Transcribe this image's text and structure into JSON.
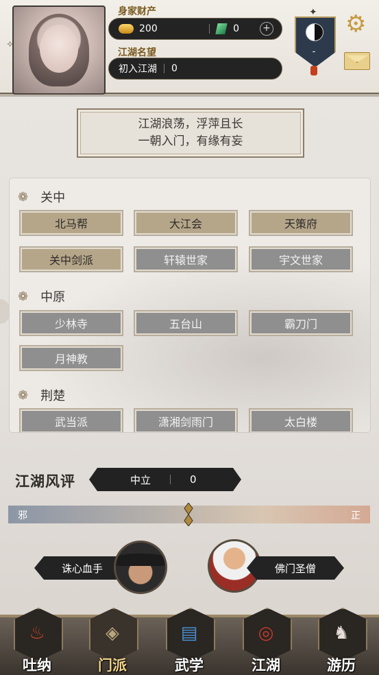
{
  "header": {
    "wealth_label": "身家财产",
    "currency1_value": "200",
    "currency2_value": "0",
    "add_symbol": "+",
    "fame_label": "江湖名望",
    "fame_title": "初入江湖",
    "fame_value": "0",
    "emblem_value": "-",
    "colors": {
      "gold": "#c79a3f",
      "dark_pill": "#232323"
    }
  },
  "motto": {
    "line1": "江湖浪荡，浮萍且长",
    "line2": "一朝入门，有缘有妄"
  },
  "regions": [
    {
      "name": "关中",
      "sects": [
        {
          "label": "北马帮",
          "style": "tan"
        },
        {
          "label": "大江会",
          "style": "tan"
        },
        {
          "label": "天策府",
          "style": "tan"
        },
        {
          "label": "关中剑派",
          "style": "tan"
        },
        {
          "label": "轩辕世家",
          "style": "gray"
        },
        {
          "label": "宇文世家",
          "style": "gray"
        }
      ]
    },
    {
      "name": "中原",
      "sects": [
        {
          "label": "少林寺",
          "style": "gray"
        },
        {
          "label": "五台山",
          "style": "gray"
        },
        {
          "label": "霸刀门",
          "style": "gray"
        },
        {
          "label": "月神教",
          "style": "gray"
        }
      ]
    },
    {
      "name": "荆楚",
      "sects": [
        {
          "label": "武当派",
          "style": "gray"
        },
        {
          "label": "潇湘剑雨门",
          "style": "gray"
        },
        {
          "label": "太白楼",
          "style": "gray"
        }
      ]
    }
  ],
  "reputation": {
    "title": "江湖风评",
    "alignment": "中立",
    "score": "0",
    "left_label": "邪",
    "right_label": "正"
  },
  "archetypes": {
    "evil": "诛心血手",
    "good": "佛门圣僧"
  },
  "nav": [
    {
      "label": "吐纳",
      "icon": "meditation-icon"
    },
    {
      "label": "门派",
      "icon": "sect-icon",
      "active": true
    },
    {
      "label": "武学",
      "icon": "martial-book-icon"
    },
    {
      "label": "江湖",
      "icon": "world-icon"
    },
    {
      "label": "游历",
      "icon": "horse-icon"
    }
  ]
}
